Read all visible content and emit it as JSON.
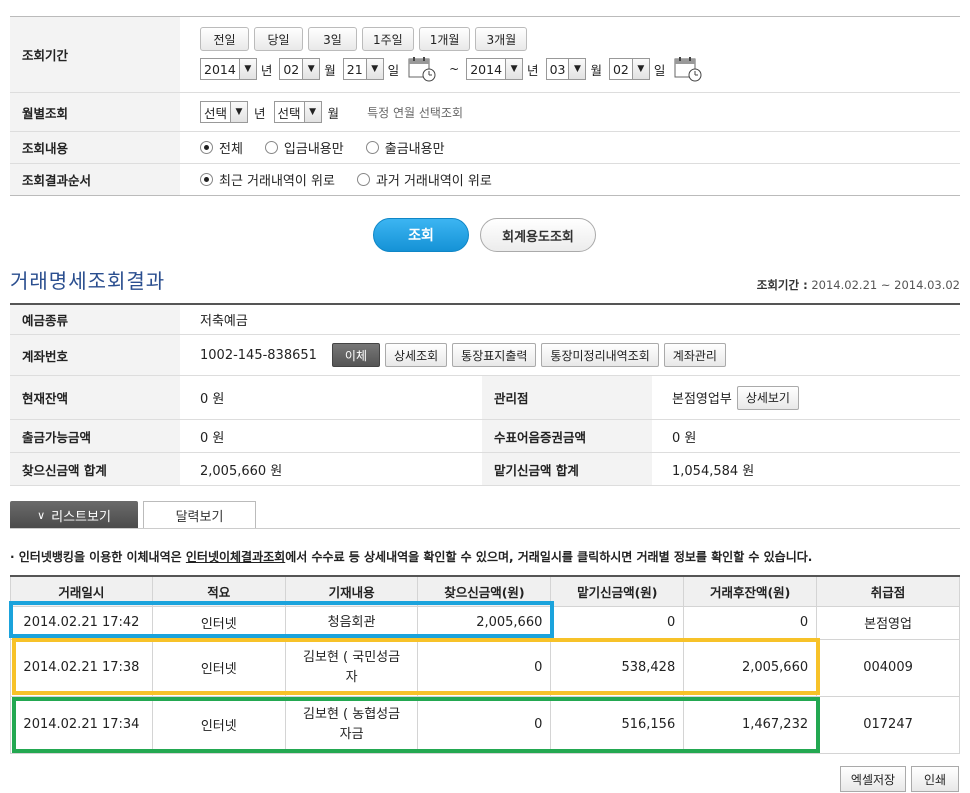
{
  "search": {
    "period_label": "조회기간",
    "period_buttons": [
      "전일",
      "당일",
      "3일",
      "1주일",
      "1개월",
      "3개월"
    ],
    "from": {
      "year": "2014",
      "month": "02",
      "day": "21"
    },
    "to": {
      "year": "2014",
      "month": "03",
      "day": "02"
    },
    "unit_year": "년",
    "unit_month": "월",
    "unit_day": "일",
    "tilde": "~",
    "monthly_label": "월별조회",
    "monthly_select_year": "선택",
    "monthly_select_month": "선택",
    "monthly_hint": "특정 연월 선택조회",
    "content_label": "조회내용",
    "content_options": [
      "전체",
      "입금내용만",
      "출금내용만"
    ],
    "order_label": "조회결과순서",
    "order_options": [
      "최근 거래내역이 위로",
      "과거 거래내역이 위로"
    ],
    "search_button": "조회",
    "acct_use_button": "회계용도조회"
  },
  "result": {
    "title": "거래명세조회결과",
    "period_label": "조회기간 :",
    "period_value": "2014.02.21 ~ 2014.03.02",
    "deposit_type_label": "예금종류",
    "deposit_type": "저축예금",
    "account_label": "계좌번호",
    "account_no": "1002-145-838651",
    "account_buttons": [
      "이체",
      "상세조회",
      "통장표지출력",
      "통장미정리내역조회",
      "계좌관리"
    ],
    "balance_label": "현재잔액",
    "balance": "0 원",
    "branch_label": "관리점",
    "branch": "본점영업부",
    "branch_detail_button": "상세보기",
    "withdrawable_label": "출금가능금액",
    "withdrawable": "0 원",
    "bill_label": "수표어음증권금액",
    "bill": "0 원",
    "withdraw_total_label": "찾으신금액 합계",
    "withdraw_total": "2,005,660 원",
    "deposit_total_label": "맡기신금액 합계",
    "deposit_total": "1,054,584 원"
  },
  "tabs": {
    "list": "리스트보기",
    "calendar": "달력보기"
  },
  "notice": {
    "prefix": "인터넷뱅킹을 이용한 이체내역은 ",
    "link": "인터넷이체결과조회",
    "suffix": "에서 수수료 등 상세내역을 확인할 수 있으며, 거래일시를 클릭하시면 거래별 정보를 확인할 수 있습니다."
  },
  "table": {
    "headers": [
      "거래일시",
      "적요",
      "기재내용",
      "찾으신금액(원)",
      "맡기신금액(원)",
      "거래후잔액(원)",
      "취급점"
    ],
    "rows": [
      [
        "2014.02.21 17:42",
        "인터넷",
        "청음회관",
        "2,005,660",
        "0",
        "0",
        "본점영업"
      ],
      [
        "2014.02.21 17:38",
        "인터넷",
        "김보현 ( 국민성금자",
        "0",
        "538,428",
        "2,005,660",
        "004009"
      ],
      [
        "2014.02.21 17:34",
        "인터넷",
        "김보현 ( 농협성금자금",
        "0",
        "516,156",
        "1,467,232",
        "017247"
      ]
    ]
  },
  "footer": {
    "excel": "엑셀저장",
    "print": "인쇄"
  },
  "colors": {
    "accent": "#1592d6",
    "title": "#2a4e8f",
    "hl_blue": "#1ba3dc",
    "hl_yellow": "#f7c229",
    "hl_green": "#23a851"
  }
}
